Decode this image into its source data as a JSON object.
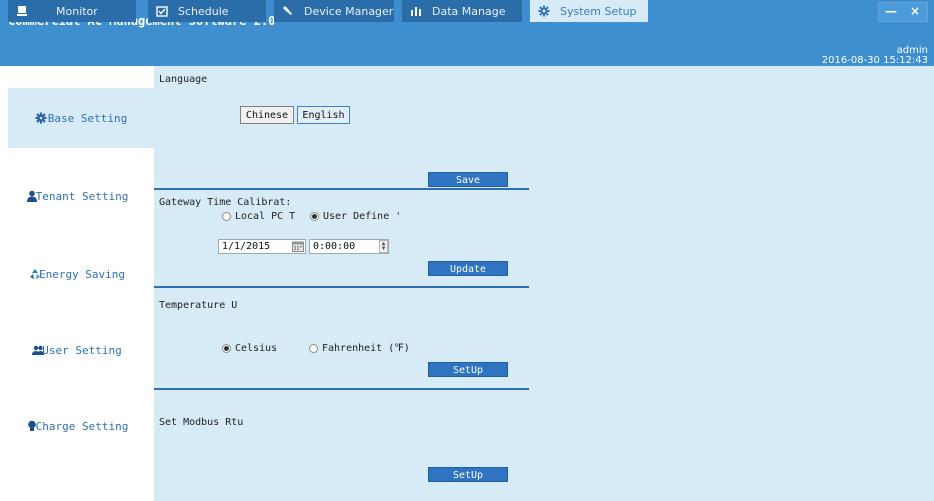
{
  "app": {
    "title": "Commercial AC Management Software 2.0"
  },
  "window_controls": {
    "minimize": "—",
    "close": "×"
  },
  "tabs": [
    {
      "label": "Monitor",
      "icon": "monitor-icon",
      "active": false
    },
    {
      "label": "Schedule",
      "icon": "schedule-icon",
      "active": false
    },
    {
      "label": "Device Manager",
      "icon": "wrench-icon",
      "active": false
    },
    {
      "label": "Data Manage",
      "icon": "bar-chart-icon",
      "active": false
    },
    {
      "label": "System Setup",
      "icon": "gear-icon",
      "active": true
    }
  ],
  "user": {
    "name": "admin",
    "datetime": "2016-08-30 15:12:43"
  },
  "sidebar": {
    "items": [
      {
        "label": "Base Setting",
        "icon": "gear-icon",
        "active": true
      },
      {
        "label": "Tenant Setting",
        "icon": "person-icon",
        "active": false
      },
      {
        "label": "Energy Saving",
        "icon": "recycle-icon",
        "active": false
      },
      {
        "label": "User Setting",
        "icon": "users-icon",
        "active": false
      },
      {
        "label": "Charge Setting",
        "icon": "bulb-icon",
        "active": false
      }
    ]
  },
  "language": {
    "label": "Language",
    "options": [
      "Chinese",
      "English"
    ],
    "selected": "English",
    "save_label": "Save"
  },
  "gateway_time": {
    "label": "Gateway Time Calibrat:",
    "radio_local": "Local PC T",
    "radio_user": "User Define '",
    "selected": "User Define",
    "date_value": "1/1/2015",
    "time_value": "0:00:00",
    "update_label": "Update"
  },
  "temperature": {
    "label": "Temperature U",
    "radio_celsius": "Celsius",
    "radio_fahrenheit": "Fahrenheit (℉)",
    "selected": "Celsius",
    "setup_label": "SetUp"
  },
  "modbus": {
    "label": "Set Modbus Rtu",
    "setup_label": "SetUp"
  },
  "colors": {
    "title_bar": "#3d8fd0",
    "tab_inactive": "#2b6da8",
    "content_bg": "#d6ebf6",
    "button_blue": "#2e74c0",
    "sidebar_text": "#2f6fb5"
  }
}
